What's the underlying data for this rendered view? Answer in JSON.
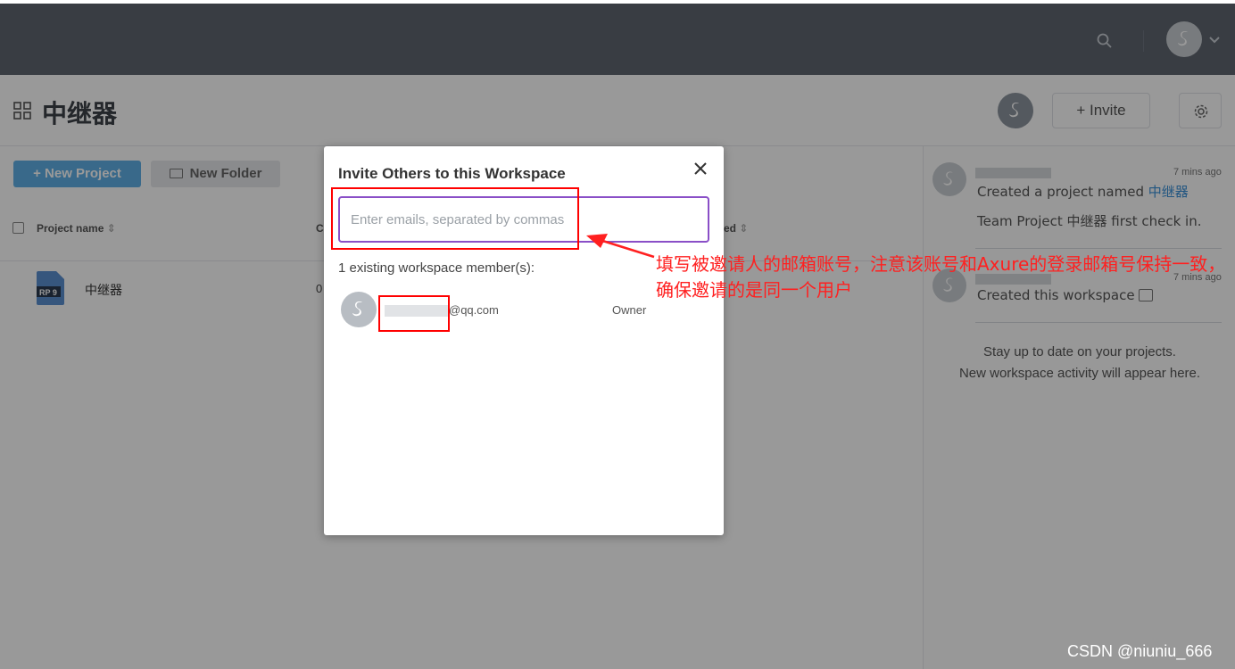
{
  "workspace": {
    "title": "中继器"
  },
  "header": {
    "invite_label": "+ Invite"
  },
  "toolbar": {
    "new_project": "+ New Project",
    "new_folder": "New Folder"
  },
  "table": {
    "columns": [
      "Project name",
      "C",
      "ed"
    ],
    "rows": [
      {
        "name": "中继器",
        "cell": "0",
        "badge": "RP 9"
      }
    ]
  },
  "activity": [
    {
      "time": "7 mins ago",
      "line1_prefix": "Created a project named ",
      "line1_link": "中继器",
      "line2": "Team Project 中继器 first check in."
    },
    {
      "time": "7 mins ago",
      "line1": "Created this workspace"
    }
  ],
  "empty_state": {
    "line1": "Stay up to date on your projects.",
    "line2": "New workspace activity will appear here."
  },
  "modal": {
    "title": "Invite Others to this Workspace",
    "email_placeholder": "Enter emails, separated by commas",
    "member_count": "1 existing workspace member(s):",
    "member_email": "@qq.com",
    "member_role": "Owner"
  },
  "annotation": {
    "text": "填写被邀请人的邮箱账号，注意该账号和Axure的登录邮箱号保持一致，确保邀请的是同一个用户"
  },
  "watermark": "CSDN @niuniu_666",
  "colors": {
    "topbar": "#5f6670",
    "accent_blue": "#5fb0e6",
    "input_border": "#8a4fc7",
    "annotation_red": "#ff0000"
  }
}
